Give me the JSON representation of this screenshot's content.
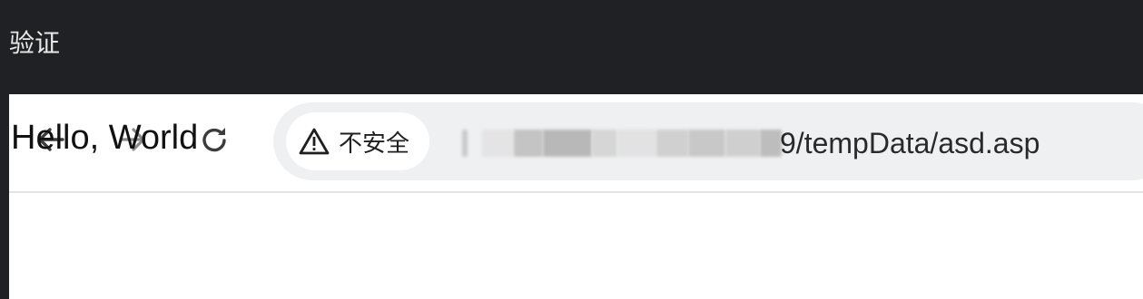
{
  "header": {
    "title": "验证"
  },
  "browser": {
    "nav": {
      "back_icon": "arrow-left-icon",
      "forward_icon": "arrow-right-icon",
      "reload_icon": "reload-icon"
    },
    "address_bar": {
      "security_label": "不安全",
      "security_icon": "warning-triangle-icon",
      "url_visible_part": "9/tempData/asd.asp"
    }
  },
  "page": {
    "body_text": "Hello, World"
  },
  "colors": {
    "top_bar_bg": "#202124",
    "omnibox_bg": "#eef0f1",
    "page_bg": "#ffffff"
  }
}
